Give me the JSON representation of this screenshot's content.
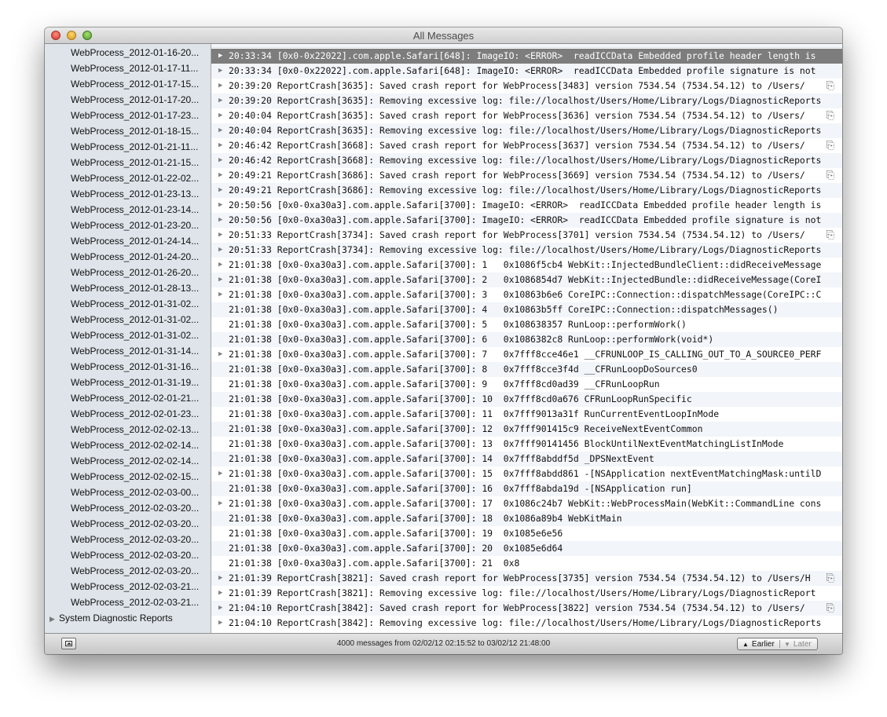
{
  "window": {
    "title": "All Messages"
  },
  "sidebar": {
    "items": [
      "WebProcess_2012-01-16-20...",
      "WebProcess_2012-01-17-11...",
      "WebProcess_2012-01-17-15...",
      "WebProcess_2012-01-17-20...",
      "WebProcess_2012-01-17-23...",
      "WebProcess_2012-01-18-15...",
      "WebProcess_2012-01-21-11...",
      "WebProcess_2012-01-21-15...",
      "WebProcess_2012-01-22-02...",
      "WebProcess_2012-01-23-13...",
      "WebProcess_2012-01-23-14...",
      "WebProcess_2012-01-23-20...",
      "WebProcess_2012-01-24-14...",
      "WebProcess_2012-01-24-20...",
      "WebProcess_2012-01-26-20...",
      "WebProcess_2012-01-28-13...",
      "WebProcess_2012-01-31-02...",
      "WebProcess_2012-01-31-02...",
      "WebProcess_2012-01-31-02...",
      "WebProcess_2012-01-31-14...",
      "WebProcess_2012-01-31-16...",
      "WebProcess_2012-01-31-19...",
      "WebProcess_2012-02-01-21...",
      "WebProcess_2012-02-01-23...",
      "WebProcess_2012-02-02-13...",
      "WebProcess_2012-02-02-14...",
      "WebProcess_2012-02-02-14...",
      "WebProcess_2012-02-02-15...",
      "WebProcess_2012-02-03-00...",
      "WebProcess_2012-02-03-20...",
      "WebProcess_2012-02-03-20...",
      "WebProcess_2012-02-03-20...",
      "WebProcess_2012-02-03-20...",
      "WebProcess_2012-02-03-20...",
      "WebProcess_2012-02-03-21...",
      "WebProcess_2012-02-03-21..."
    ],
    "group": "System Diagnostic Reports"
  },
  "messages": [
    {
      "text": "20:33:34 [0x0-0x22022].com.apple.Safari[648]: ImageIO: <ERROR>  readICCData Embedded profile header length is",
      "expand": true,
      "attach": false,
      "selected": true
    },
    {
      "text": "20:33:34 [0x0-0x22022].com.apple.Safari[648]: ImageIO: <ERROR>  readICCData Embedded profile signature is not",
      "expand": true,
      "attach": false
    },
    {
      "text": "20:39:20 ReportCrash[3635]: Saved crash report for WebProcess[3483] version 7534.54 (7534.54.12) to /Users/",
      "expand": true,
      "attach": true
    },
    {
      "text": "20:39:20 ReportCrash[3635]: Removing excessive log: file://localhost/Users/Home/Library/Logs/DiagnosticReports",
      "expand": true,
      "attach": false
    },
    {
      "text": "20:40:04 ReportCrash[3635]: Saved crash report for WebProcess[3636] version 7534.54 (7534.54.12) to /Users/",
      "expand": true,
      "attach": true
    },
    {
      "text": "20:40:04 ReportCrash[3635]: Removing excessive log: file://localhost/Users/Home/Library/Logs/DiagnosticReports",
      "expand": true,
      "attach": false
    },
    {
      "text": "20:46:42 ReportCrash[3668]: Saved crash report for WebProcess[3637] version 7534.54 (7534.54.12) to /Users/",
      "expand": true,
      "attach": true
    },
    {
      "text": "20:46:42 ReportCrash[3668]: Removing excessive log: file://localhost/Users/Home/Library/Logs/DiagnosticReports",
      "expand": true,
      "attach": false
    },
    {
      "text": "20:49:21 ReportCrash[3686]: Saved crash report for WebProcess[3669] version 7534.54 (7534.54.12) to /Users/",
      "expand": true,
      "attach": true
    },
    {
      "text": "20:49:21 ReportCrash[3686]: Removing excessive log: file://localhost/Users/Home/Library/Logs/DiagnosticReports",
      "expand": true,
      "attach": false
    },
    {
      "text": "20:50:56 [0x0-0xa30a3].com.apple.Safari[3700]: ImageIO: <ERROR>  readICCData Embedded profile header length is",
      "expand": true,
      "attach": false
    },
    {
      "text": "20:50:56 [0x0-0xa30a3].com.apple.Safari[3700]: ImageIO: <ERROR>  readICCData Embedded profile signature is not",
      "expand": true,
      "attach": false
    },
    {
      "text": "20:51:33 ReportCrash[3734]: Saved crash report for WebProcess[3701] version 7534.54 (7534.54.12) to /Users/",
      "expand": true,
      "attach": true
    },
    {
      "text": "20:51:33 ReportCrash[3734]: Removing excessive log: file://localhost/Users/Home/Library/Logs/DiagnosticReports",
      "expand": true,
      "attach": false
    },
    {
      "text": "21:01:38 [0x0-0xa30a3].com.apple.Safari[3700]: 1   0x1086f5cb4 WebKit::InjectedBundleClient::didReceiveMessage",
      "expand": true,
      "attach": false
    },
    {
      "text": "21:01:38 [0x0-0xa30a3].com.apple.Safari[3700]: 2   0x1086854d7 WebKit::InjectedBundle::didReceiveMessage(CoreI",
      "expand": true,
      "attach": false
    },
    {
      "text": "21:01:38 [0x0-0xa30a3].com.apple.Safari[3700]: 3   0x10863b6e6 CoreIPC::Connection::dispatchMessage(CoreIPC::C",
      "expand": true,
      "attach": false
    },
    {
      "text": "21:01:38 [0x0-0xa30a3].com.apple.Safari[3700]: 4   0x10863b5ff CoreIPC::Connection::dispatchMessages()",
      "expand": false,
      "attach": false
    },
    {
      "text": "21:01:38 [0x0-0xa30a3].com.apple.Safari[3700]: 5   0x108638357 RunLoop::performWork()",
      "expand": false,
      "attach": false
    },
    {
      "text": "21:01:38 [0x0-0xa30a3].com.apple.Safari[3700]: 6   0x1086382c8 RunLoop::performWork(void*)",
      "expand": false,
      "attach": false
    },
    {
      "text": "21:01:38 [0x0-0xa30a3].com.apple.Safari[3700]: 7   0x7fff8cce46e1 __CFRUNLOOP_IS_CALLING_OUT_TO_A_SOURCE0_PERF",
      "expand": true,
      "attach": false
    },
    {
      "text": "21:01:38 [0x0-0xa30a3].com.apple.Safari[3700]: 8   0x7fff8cce3f4d __CFRunLoopDoSources0",
      "expand": false,
      "attach": false
    },
    {
      "text": "21:01:38 [0x0-0xa30a3].com.apple.Safari[3700]: 9   0x7fff8cd0ad39 __CFRunLoopRun",
      "expand": false,
      "attach": false
    },
    {
      "text": "21:01:38 [0x0-0xa30a3].com.apple.Safari[3700]: 10  0x7fff8cd0a676 CFRunLoopRunSpecific",
      "expand": false,
      "attach": false
    },
    {
      "text": "21:01:38 [0x0-0xa30a3].com.apple.Safari[3700]: 11  0x7fff9013a31f RunCurrentEventLoopInMode",
      "expand": false,
      "attach": false
    },
    {
      "text": "21:01:38 [0x0-0xa30a3].com.apple.Safari[3700]: 12  0x7fff901415c9 ReceiveNextEventCommon",
      "expand": false,
      "attach": false
    },
    {
      "text": "21:01:38 [0x0-0xa30a3].com.apple.Safari[3700]: 13  0x7fff90141456 BlockUntilNextEventMatchingListInMode",
      "expand": false,
      "attach": false
    },
    {
      "text": "21:01:38 [0x0-0xa30a3].com.apple.Safari[3700]: 14  0x7fff8abddf5d _DPSNextEvent",
      "expand": false,
      "attach": false
    },
    {
      "text": "21:01:38 [0x0-0xa30a3].com.apple.Safari[3700]: 15  0x7fff8abdd861 -[NSApplication nextEventMatchingMask:untilD",
      "expand": true,
      "attach": false
    },
    {
      "text": "21:01:38 [0x0-0xa30a3].com.apple.Safari[3700]: 16  0x7fff8abda19d -[NSApplication run]",
      "expand": false,
      "attach": false
    },
    {
      "text": "21:01:38 [0x0-0xa30a3].com.apple.Safari[3700]: 17  0x1086c24b7 WebKit::WebProcessMain(WebKit::CommandLine cons",
      "expand": true,
      "attach": false
    },
    {
      "text": "21:01:38 [0x0-0xa30a3].com.apple.Safari[3700]: 18  0x1086a89b4 WebKitMain",
      "expand": false,
      "attach": false
    },
    {
      "text": "21:01:38 [0x0-0xa30a3].com.apple.Safari[3700]: 19  0x1085e6e56",
      "expand": false,
      "attach": false
    },
    {
      "text": "21:01:38 [0x0-0xa30a3].com.apple.Safari[3700]: 20  0x1085e6d64",
      "expand": false,
      "attach": false
    },
    {
      "text": "21:01:38 [0x0-0xa30a3].com.apple.Safari[3700]: 21  0x8",
      "expand": false,
      "attach": false
    },
    {
      "text": "21:01:39 ReportCrash[3821]: Saved crash report for WebProcess[3735] version 7534.54 (7534.54.12) to /Users/H",
      "expand": true,
      "attach": true
    },
    {
      "text": "21:01:39 ReportCrash[3821]: Removing excessive log: file://localhost/Users/Home/Library/Logs/DiagnosticReport",
      "expand": true,
      "attach": false
    },
    {
      "text": "21:04:10 ReportCrash[3842]: Saved crash report for WebProcess[3822] version 7534.54 (7534.54.12) to /Users/",
      "expand": true,
      "attach": true
    },
    {
      "text": "21:04:10 ReportCrash[3842]: Removing excessive log: file://localhost/Users/Home/Library/Logs/DiagnosticReports",
      "expand": true,
      "attach": false
    }
  ],
  "status_text": "4000 messages from 02/02/12 02:15:52 to 03/02/12 21:48:00",
  "nav": {
    "earlier": "Earlier",
    "later": "Later"
  },
  "colors": {
    "selected_row": "#7d7d7d",
    "sidebar_bg": "#dee4ea",
    "stripe": "#f2f5f9"
  }
}
